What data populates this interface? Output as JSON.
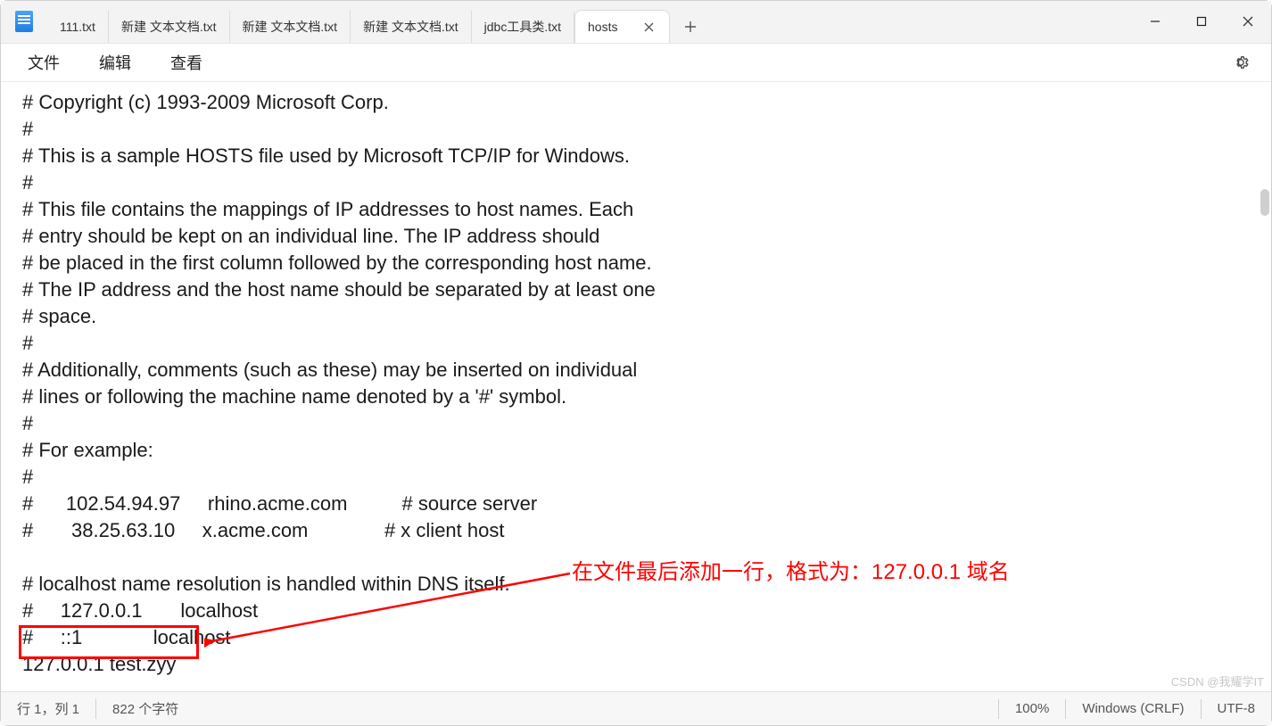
{
  "tabs": [
    {
      "label": "111.txt"
    },
    {
      "label": "新建 文本文档.txt"
    },
    {
      "label": "新建 文本文档.txt"
    },
    {
      "label": "新建 文本文档.txt"
    },
    {
      "label": "jdbc工具类.txt"
    },
    {
      "label": "hosts",
      "active": true
    }
  ],
  "menus": {
    "file": "文件",
    "edit": "编辑",
    "view": "查看"
  },
  "editor_text": "# Copyright (c) 1993-2009 Microsoft Corp.\n#\n# This is a sample HOSTS file used by Microsoft TCP/IP for Windows.\n#\n# This file contains the mappings of IP addresses to host names. Each\n# entry should be kept on an individual line. The IP address should\n# be placed in the first column followed by the corresponding host name.\n# The IP address and the host name should be separated by at least one\n# space.\n#\n# Additionally, comments (such as these) may be inserted on individual\n# lines or following the machine name denoted by a '#' symbol.\n#\n# For example:\n#\n#      102.54.94.97     rhino.acme.com          # source server\n#       38.25.63.10     x.acme.com              # x client host\n\n# localhost name resolution is handled within DNS itself.\n#     127.0.0.1       localhost\n#     ::1             localhost\n127.0.0.1 test.zyy",
  "status": {
    "cursor": "行 1，列 1",
    "chars": "822 个字符",
    "zoom": "100%",
    "line_ending": "Windows (CRLF)",
    "encoding": "UTF-8"
  },
  "annotation": {
    "text": "在文件最后添加一行，格式为：127.0.0.1 域名"
  },
  "watermark": "CSDN @我耀学IT"
}
